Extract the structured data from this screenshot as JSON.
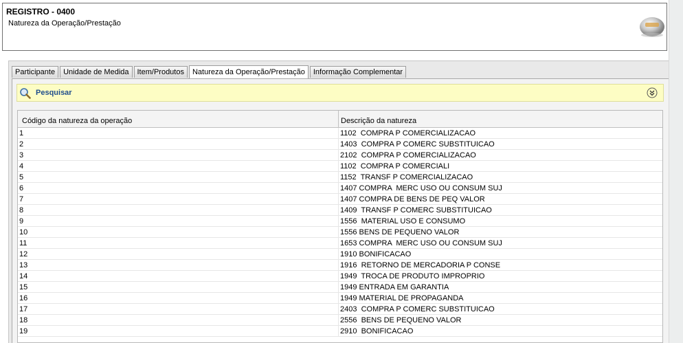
{
  "header": {
    "title": "REGISTRO - 0400",
    "subtitle": "Natureza da Operação/Prestação"
  },
  "tabs": [
    {
      "label": "Participante",
      "active": false
    },
    {
      "label": "Unidade de Medida",
      "active": false
    },
    {
      "label": "Item/Produtos",
      "active": false
    },
    {
      "label": "Natureza da Operação/Prestação",
      "active": true
    },
    {
      "label": "Informação Complementar",
      "active": false
    }
  ],
  "search": {
    "label": "Pesquisar",
    "icon": "search-icon",
    "collapse_icon": "double-chevron-down-icon"
  },
  "table": {
    "columns": [
      "Código da natureza da operação",
      "Descrição da natureza"
    ],
    "rows": [
      [
        "1",
        "1102  COMPRA P COMERCIALIZACAO"
      ],
      [
        "2",
        "1403  COMPRA P COMERC SUBSTITUICAO"
      ],
      [
        "3",
        "2102  COMPRA P COMERCIALIZACAO"
      ],
      [
        "4",
        "1102  COMPRA P COMERCIALI"
      ],
      [
        "5",
        "1152  TRANSF P COMERCIALIZACAO"
      ],
      [
        "6",
        "1407 COMPRA  MERC USO OU CONSUM SUJ"
      ],
      [
        "7",
        "1407 COMPRA DE BENS DE PEQ VALOR"
      ],
      [
        "8",
        "1409  TRANSF P COMERC SUBSTITUICAO"
      ],
      [
        "9",
        "1556  MATERIAL USO E CONSUMO"
      ],
      [
        "10",
        "1556 BENS DE PEQUENO VALOR"
      ],
      [
        "11",
        "1653 COMPRA  MERC USO OU CONSUM SUJ"
      ],
      [
        "12",
        "1910 BONIFICACAO"
      ],
      [
        "13",
        "1916  RETORNO DE MERCADORIA P CONSE"
      ],
      [
        "14",
        "1949  TROCA DE PRODUTO IMPROPRIO"
      ],
      [
        "15",
        "1949 ENTRADA EM GARANTIA"
      ],
      [
        "16",
        "1949 MATERIAL DE PROPAGANDA"
      ],
      [
        "17",
        "2403  COMPRA P COMERC SUBSTITUICAO"
      ],
      [
        "18",
        "2556  BENS DE PEQUENO VALOR"
      ],
      [
        "19",
        "2910  BONIFICACAO"
      ]
    ]
  },
  "colors": {
    "search_bg": "#fdfdc4",
    "search_label": "#1f4e8c",
    "panel_bg": "#e9e9e9"
  }
}
